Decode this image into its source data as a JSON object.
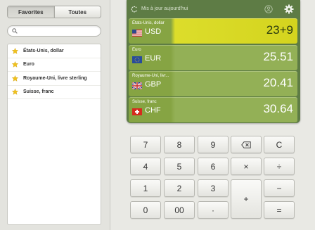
{
  "left": {
    "tabs": [
      "Favorites",
      "Toutes"
    ],
    "search": {
      "placeholder": "",
      "value": ""
    },
    "favorites": [
      {
        "name": "États-Unis, dollar",
        "icon": "star-icon"
      },
      {
        "name": "Euro",
        "icon": "star-icon"
      },
      {
        "name": "Royaume-Uni, livre sterling",
        "icon": "star-icon"
      },
      {
        "name": "Suisse, franc",
        "icon": "star-icon"
      }
    ]
  },
  "board": {
    "updated": "Mis à jour aujourd'hui",
    "rows": [
      {
        "name": "États-Unis, dollar",
        "code": "USD",
        "value": "23+9",
        "flag": "us-flag-icon"
      },
      {
        "name": "Euro",
        "code": "EUR",
        "value": "25.51",
        "flag": "eu-flag-icon"
      },
      {
        "name": "Royaume-Uni, livr...",
        "code": "GBP",
        "value": "20.41",
        "flag": "uk-flag-icon"
      },
      {
        "name": "Suisse, franc",
        "code": "CHF",
        "value": "30.64",
        "flag": "ch-flag-icon"
      }
    ]
  },
  "keypad": {
    "k7": "7",
    "k8": "8",
    "k9": "9",
    "clear": "C",
    "k4": "4",
    "k5": "5",
    "k6": "6",
    "multiply": "×",
    "divide": "÷",
    "k1": "1",
    "k2": "2",
    "k3": "3",
    "minus": "−",
    "k0": "0",
    "k00": "00",
    "dot": "·",
    "plus": "+",
    "equals": "="
  },
  "colors": {
    "board": "#5e7c45",
    "row": "#8fab52",
    "selected_row": "#dbdc2a"
  }
}
